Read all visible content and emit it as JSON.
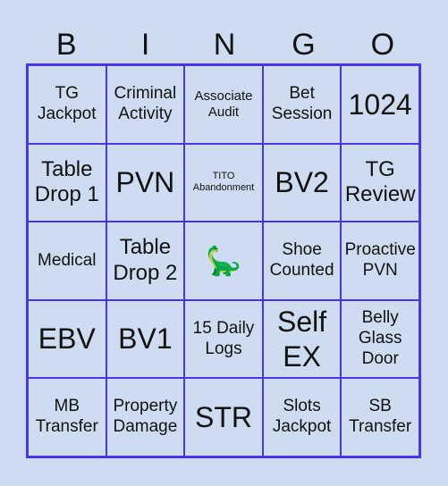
{
  "header": [
    "B",
    "I",
    "N",
    "G",
    "O"
  ],
  "cells": [
    "TG Jackpot",
    "Criminal Activity",
    "Associate Audit",
    "Bet Session",
    "1024",
    "Table Drop 1",
    "PVN",
    "TITO Abandonment",
    "BV2",
    "TG Review",
    "Medical",
    "Table Drop 2",
    "🦕",
    "Shoe Counted",
    "Proactive PVN",
    "EBV",
    "BV1",
    "15 Daily Logs",
    "Self EX",
    "Belly Glass Door",
    "MB Transfer",
    "Property Damage",
    "STR",
    "Slots Jackpot",
    "SB Transfer"
  ],
  "colors": {
    "background": "#cddcf0",
    "grid": "#4a35ee"
  }
}
